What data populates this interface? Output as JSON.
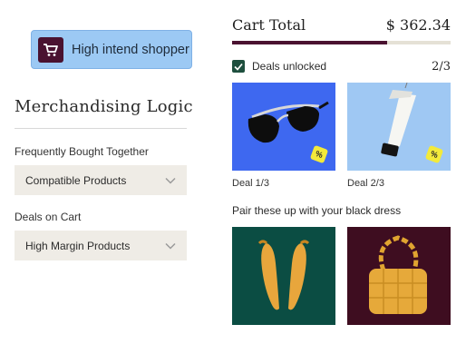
{
  "shopper": {
    "label": "High intend shopper",
    "icon": "shopping-cart-icon"
  },
  "merch": {
    "title": "Merchandising Logic",
    "fbt_label": "Frequently Bought Together",
    "fbt_value": "Compatible Products",
    "deals_label": "Deals on Cart",
    "deals_value": "High Margin Products"
  },
  "cart": {
    "title": "Cart Total",
    "amount": "$ 362.34",
    "progress": 0.71,
    "deals_unlocked_label": "Deals unlocked",
    "deals_count": "2/3"
  },
  "deals": [
    {
      "caption": "Deal 1/3",
      "product": "sunglasses",
      "badge": "%"
    },
    {
      "caption": "Deal 2/3",
      "product": "lotion-tube",
      "badge": "%"
    }
  ],
  "pairing": {
    "title": "Pair these up with your black dress",
    "products": [
      "yellow-heels",
      "yellow-quilted-bag"
    ]
  },
  "colors": {
    "accent": "#4a1230",
    "chip": "#9cc9f4",
    "select_bg": "#efece6",
    "checkbox": "#1e4f3e"
  }
}
